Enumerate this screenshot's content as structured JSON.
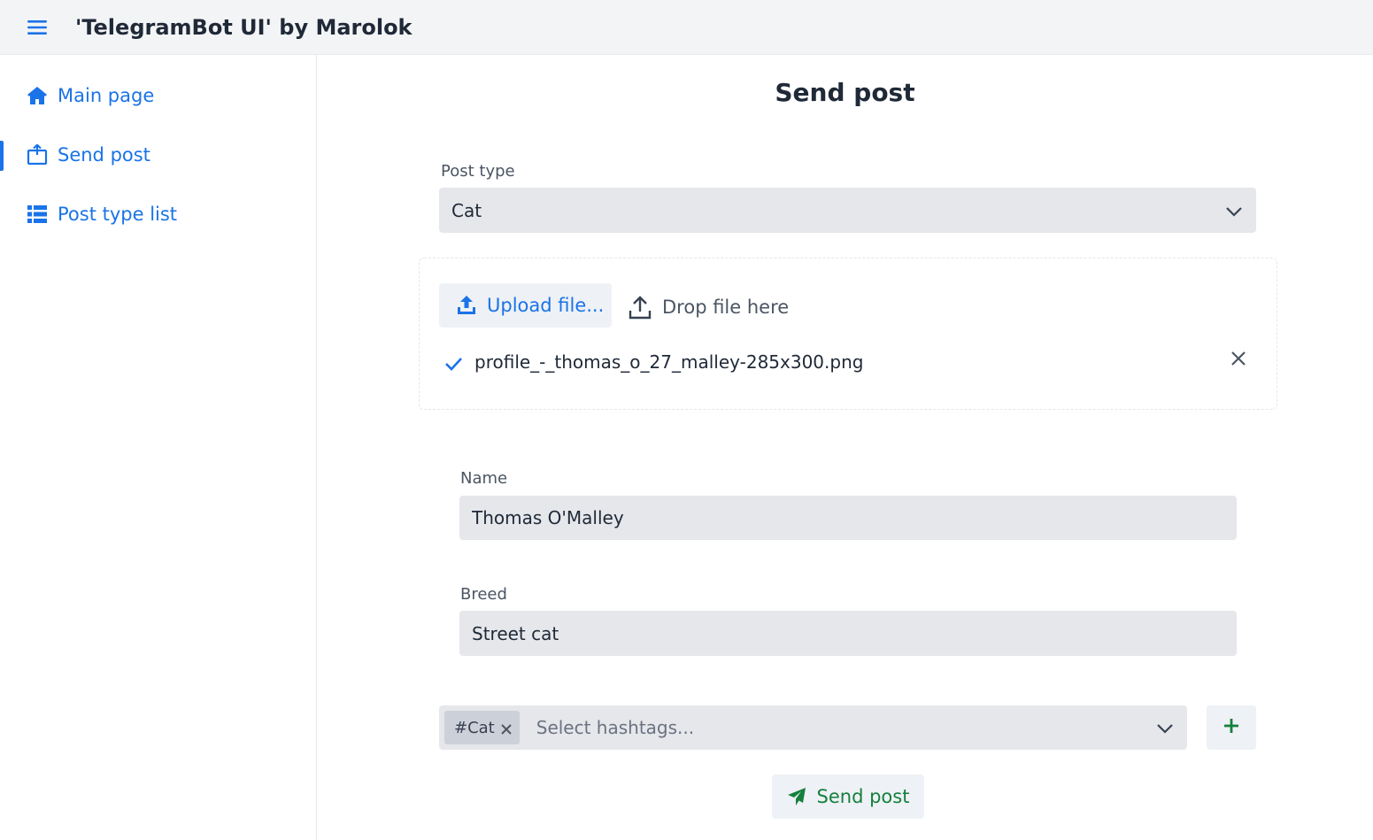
{
  "header": {
    "title": "'TelegramBot UI' by Marolok",
    "menu_icon": "hamburger-menu-icon"
  },
  "sidebar": {
    "items": [
      {
        "label": "Main page",
        "icon": "home-icon",
        "active": false
      },
      {
        "label": "Send post",
        "icon": "send-post-icon",
        "active": true
      },
      {
        "label": "Post type list",
        "icon": "list-icon",
        "active": false
      }
    ]
  },
  "main": {
    "title": "Send post",
    "post_type": {
      "label": "Post type",
      "value": "Cat"
    },
    "upload": {
      "button_label": "Upload file...",
      "drop_label": "Drop file here",
      "file_name": "profile_-_thomas_o_27_malley-285x300.png"
    },
    "fields": {
      "name": {
        "label": "Name",
        "value": "Thomas O'Malley"
      },
      "breed": {
        "label": "Breed",
        "value": "Street cat"
      }
    },
    "hashtags": {
      "selected": [
        "#Cat"
      ],
      "placeholder": "Select hashtags..."
    },
    "send_button": "Send post"
  },
  "colors": {
    "accent": "#1a73e8",
    "success": "#15803d",
    "field_bg": "#e5e7eb",
    "topbar_bg": "#f3f4f6"
  }
}
